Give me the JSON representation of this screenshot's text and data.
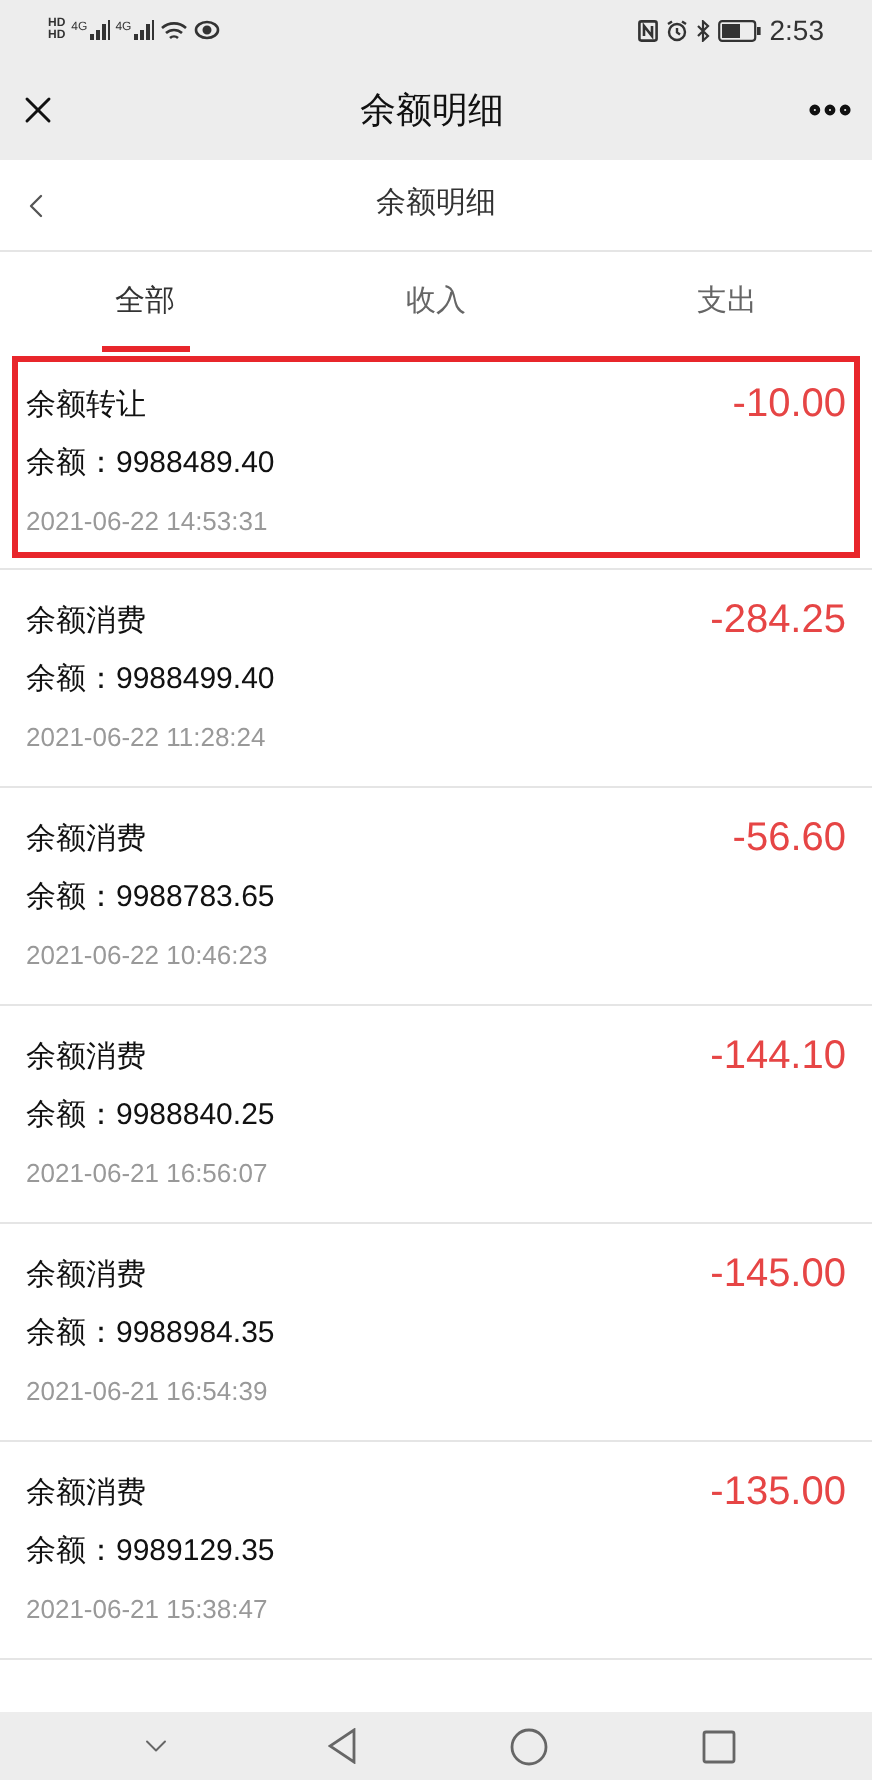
{
  "status_bar": {
    "sim_labels": [
      "HD",
      "HD"
    ],
    "network_labels": [
      "4G",
      "4G"
    ],
    "time": "2:53"
  },
  "app_bar": {
    "title": "余额明细"
  },
  "page_header": {
    "title": "余额明细"
  },
  "tabs": [
    {
      "label": "全部",
      "selected": true
    },
    {
      "label": "收入",
      "selected": false
    },
    {
      "label": "支出",
      "selected": false
    }
  ],
  "records": [
    {
      "title": "余额转让",
      "amount": "-10.00",
      "balance": "余额：9988489.40",
      "time": "2021-06-22 14:53:31",
      "highlighted": true
    },
    {
      "title": "余额消费",
      "amount": "-284.25",
      "balance": "余额：9988499.40",
      "time": "2021-06-22 11:28:24",
      "highlighted": false
    },
    {
      "title": "余额消费",
      "amount": "-56.60",
      "balance": "余额：9988783.65",
      "time": "2021-06-22 10:46:23",
      "highlighted": false
    },
    {
      "title": "余额消费",
      "amount": "-144.10",
      "balance": "余额：9988840.25",
      "time": "2021-06-21 16:56:07",
      "highlighted": false
    },
    {
      "title": "余额消费",
      "amount": "-145.00",
      "balance": "余额：9988984.35",
      "time": "2021-06-21 16:54:39",
      "highlighted": false
    },
    {
      "title": "余额消费",
      "amount": "-135.00",
      "balance": "余额：9989129.35",
      "time": "2021-06-21 15:38:47",
      "highlighted": false
    }
  ]
}
